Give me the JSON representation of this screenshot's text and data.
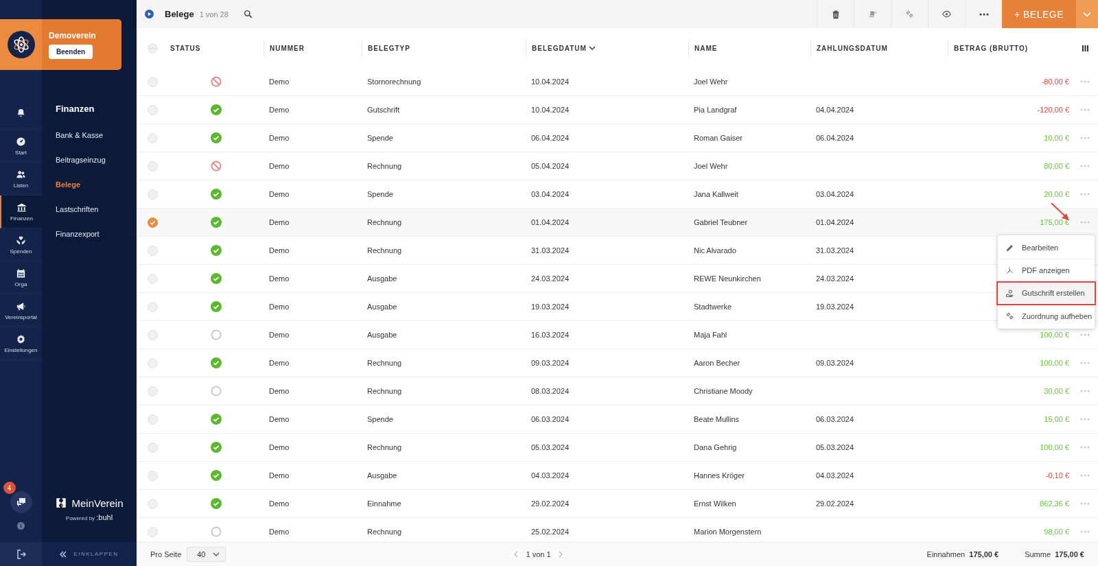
{
  "org": {
    "name": "Demoverein",
    "button": "Beenden"
  },
  "rail": [
    {
      "kind": "bell",
      "selected": false
    },
    {
      "kind": "gauge",
      "label": "Start",
      "selected": false
    },
    {
      "kind": "people",
      "label": "Listen",
      "selected": false
    },
    {
      "kind": "bank",
      "label": "Finanzen",
      "selected": true
    },
    {
      "kind": "donation",
      "label": "Spenden",
      "selected": false
    },
    {
      "kind": "calendar",
      "label": "Orga",
      "selected": false
    },
    {
      "kind": "megaphone",
      "label": "Vereinsportal",
      "selected": false
    },
    {
      "kind": "gear",
      "label": "Einstellungen",
      "selected": false
    }
  ],
  "help_badge": "4",
  "subnav": {
    "title": "Finanzen",
    "items": [
      {
        "label": "Bank & Kasse",
        "selected": false
      },
      {
        "label": "Beitragseinzug",
        "selected": false
      },
      {
        "label": "Belege",
        "selected": true
      },
      {
        "label": "Lastschriften",
        "selected": false
      },
      {
        "label": "Finanzexport",
        "selected": false
      }
    ]
  },
  "brand": {
    "name": "MeinVerein",
    "powered": "Powered by",
    "company": ":buhl"
  },
  "collapse": "EINKLAPPEN",
  "topbar": {
    "title": "Belege",
    "count": "1 von 28",
    "add_button": "+ BELEGE"
  },
  "all_selected": false,
  "columns": [
    {
      "label": "STATUS",
      "sorted": false
    },
    {
      "label": "NUMMER",
      "sorted": false
    },
    {
      "label": "BELEGTYP",
      "sorted": false
    },
    {
      "label": "BELEGDATUM",
      "sorted": true
    },
    {
      "label": "NAME",
      "sorted": false
    },
    {
      "label": "ZAHLUNGSDATUM",
      "sorted": false
    },
    {
      "label": "BETRAG (BRUTTO)",
      "sorted": false
    }
  ],
  "rows": [
    {
      "selected": false,
      "kind": "cancelled",
      "number": "Demo",
      "type": "Stornorechnung",
      "date": "10.04.2024",
      "name": "Joel Wehr",
      "amount": "-80,00 €",
      "negative": true
    },
    {
      "selected": false,
      "kind": "done",
      "number": "Demo",
      "type": "Gutschrift",
      "date": "10.04.2024",
      "name": "Pia Landgraf",
      "payment_date": "04.04.2024",
      "amount": "-120,00 €",
      "negative": true
    },
    {
      "selected": false,
      "kind": "done",
      "number": "Demo",
      "type": "Spende",
      "date": "06.04.2024",
      "name": "Roman Gaiser",
      "payment_date": "06.04.2024",
      "amount": "10,00 €",
      "negative": false
    },
    {
      "selected": false,
      "kind": "cancelled",
      "number": "Demo",
      "type": "Rechnung",
      "date": "05.04.2024",
      "name": "Joel Wehr",
      "amount": "80,00 €",
      "negative": false
    },
    {
      "selected": false,
      "kind": "done",
      "number": "Demo",
      "type": "Spende",
      "date": "03.04.2024",
      "name": "Jana Kallweit",
      "payment_date": "03.04.2024",
      "amount": "20,00 €",
      "negative": false
    },
    {
      "selected": true,
      "kind": "done",
      "number": "Demo",
      "type": "Rechnung",
      "date": "01.04.2024",
      "name": "Gabriel Teubner",
      "payment_date": "01.04.2024",
      "amount": "175,00 €",
      "negative": false
    },
    {
      "selected": false,
      "kind": "done",
      "number": "Demo",
      "type": "Rechnung",
      "date": "31.03.2024",
      "name": "Nic Alvarado",
      "payment_date": "31.03.2024"
    },
    {
      "selected": false,
      "kind": "done",
      "number": "Demo",
      "type": "Ausgabe",
      "date": "24.03.2024",
      "name": "REWE Neunkirchen",
      "payment_date": "24.03.2024"
    },
    {
      "selected": false,
      "kind": "done",
      "number": "Demo",
      "type": "Ausgabe",
      "date": "19.03.2024",
      "name": "Stadtwerke",
      "payment_date": "19.03.2024"
    },
    {
      "selected": false,
      "kind": "open",
      "number": "Demo",
      "type": "Ausgabe",
      "date": "16.03.2024",
      "name": "Maja Fahl",
      "amount": "100,00 €",
      "negative": false
    },
    {
      "selected": false,
      "kind": "done",
      "number": "Demo",
      "type": "Rechnung",
      "date": "09.03.2024",
      "name": "Aaron Becher",
      "payment_date": "09.03.2024",
      "amount": "100,00 €",
      "negative": false
    },
    {
      "selected": false,
      "kind": "open",
      "number": "Demo",
      "type": "Rechnung",
      "date": "08.03.2024",
      "name": "Christiane Moody",
      "amount": "30,00 €",
      "negative": false
    },
    {
      "selected": false,
      "kind": "done",
      "number": "Demo",
      "type": "Spende",
      "date": "06.03.2024",
      "name": "Beate Mullins",
      "payment_date": "06.03.2024",
      "amount": "15,00 €",
      "negative": false
    },
    {
      "selected": false,
      "kind": "done",
      "number": "Demo",
      "type": "Rechnung",
      "date": "05.03.2024",
      "name": "Dana Gehrig",
      "payment_date": "05.03.2024",
      "amount": "100,00 €",
      "negative": false
    },
    {
      "selected": false,
      "kind": "done",
      "number": "Demo",
      "type": "Ausgabe",
      "date": "04.03.2024",
      "name": "Hannes Kröger",
      "payment_date": "04.03.2024",
      "amount": "-0,10 €",
      "negative": true
    },
    {
      "selected": false,
      "kind": "done",
      "number": "Demo",
      "type": "Einnahme",
      "date": "29.02.2024",
      "name": "Ernst Wilken",
      "payment_date": "29.02.2024",
      "amount": "862,36 €",
      "negative": false
    },
    {
      "selected": false,
      "kind": "open",
      "number": "Demo",
      "type": "Rechnung",
      "date": "25.02.2024",
      "name": "Marion Morgenstern",
      "amount": "98,00 €",
      "negative": false
    }
  ],
  "context_menu": {
    "items": [
      {
        "kind": "edit",
        "label": "Bearbeiten",
        "highlighted": false
      },
      {
        "kind": "pdf",
        "label": "PDF anzeigen",
        "highlighted": false
      },
      {
        "kind": "credit",
        "label": "Gutschrift erstellen",
        "highlighted": true
      },
      {
        "kind": "unlink",
        "label": "Zuordnung aufheben",
        "highlighted": false
      }
    ]
  },
  "footer": {
    "per_page_label": "Pro Seite",
    "per_page": "40",
    "pagination": "1 von 1",
    "income_label": "Einnahmen",
    "income": "175,00 €",
    "sum_label": "Summe",
    "sum": "175,00 €"
  }
}
